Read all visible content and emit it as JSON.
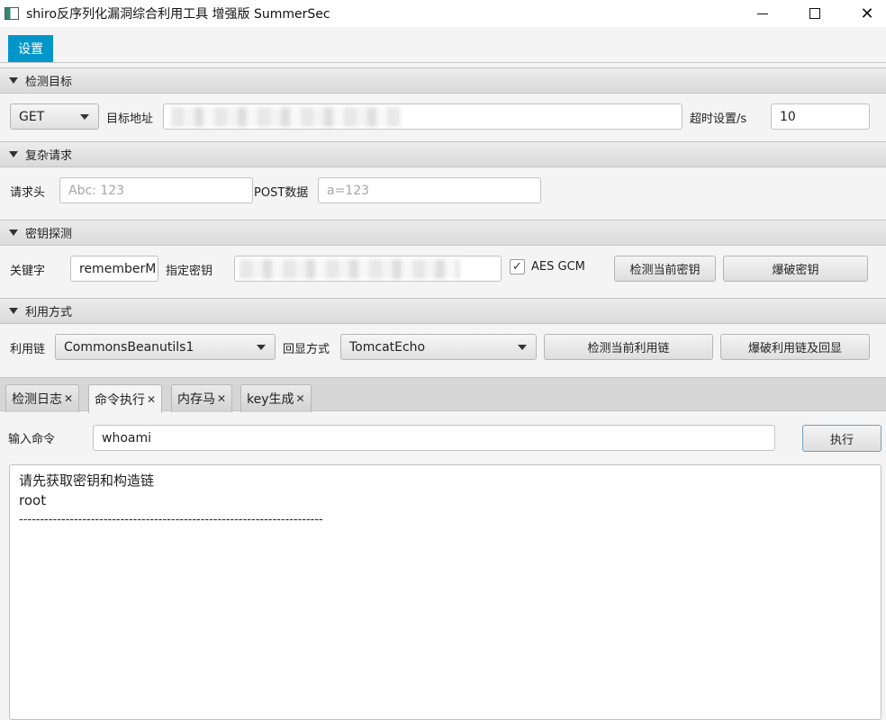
{
  "window": {
    "title": "shiro反序列化漏洞综合利用工具 增强版 SummerSec",
    "minimize": "—",
    "close": "✕"
  },
  "menu": {
    "settings": "设置"
  },
  "target": {
    "header": "检测目标",
    "method": "GET",
    "url_label": "目标地址",
    "url_value": "",
    "timeout_label": "超时设置/s",
    "timeout_value": "10"
  },
  "complex": {
    "header": "复杂请求",
    "headers_label": "请求头",
    "headers_placeholder": "Abc: 123",
    "post_label": "POST数据",
    "post_placeholder": "a=123"
  },
  "key": {
    "header": "密钥探测",
    "keyword_label": "关键字",
    "keyword_value": "rememberM",
    "key_label": "指定密钥",
    "key_value": "",
    "aes_gcm_label": "AES GCM",
    "aes_gcm_checked": "✓",
    "detect_btn": "检测当前密钥",
    "brute_btn": "爆破密钥"
  },
  "exploit": {
    "header": "利用方式",
    "chain_label": "利用链",
    "chain_value": "CommonsBeanutils1",
    "echo_label": "回显方式",
    "echo_value": "TomcatEcho",
    "detect_btn": "检测当前利用链",
    "brute_btn": "爆破利用链及回显"
  },
  "tabs": [
    {
      "label": "检测日志"
    },
    {
      "label": "命令执行"
    },
    {
      "label": "内存马"
    },
    {
      "label": "key生成"
    }
  ],
  "tab_close": "✕",
  "command": {
    "label": "输入命令",
    "value": "whoami",
    "exec_btn": "执行"
  },
  "output": {
    "lines": [
      "请先获取密钥和构造链",
      "root",
      "------------------------------------------------------------------------"
    ]
  }
}
